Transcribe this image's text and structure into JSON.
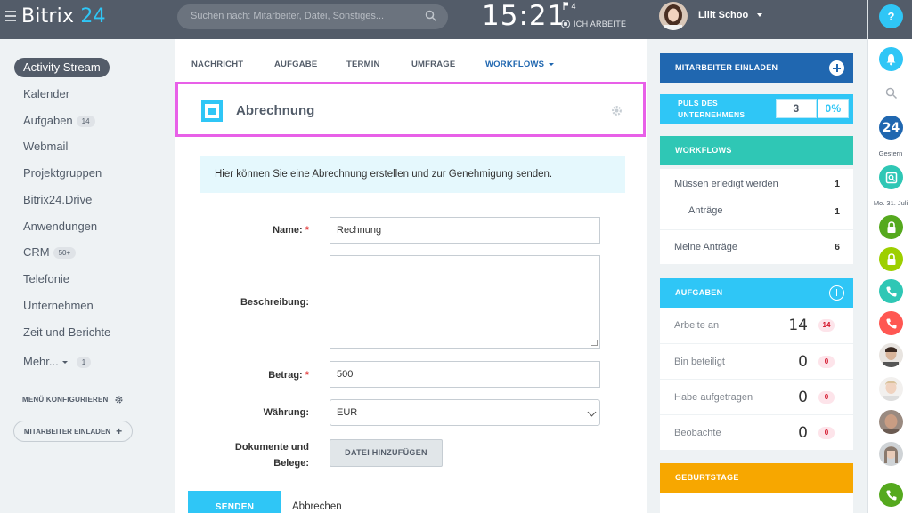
{
  "topbar": {
    "logo_word": "Bitrix",
    "logo_num": "24",
    "search_placeholder": "Suchen nach: Mitarbeiter, Datei, Sonstiges...",
    "clock": "15:21",
    "flag_count": "4",
    "work_status": "ICH ARBEITE",
    "user_name": "Lilit Schoo"
  },
  "sidebar": {
    "items": [
      {
        "label": "Activity Stream",
        "active": true
      },
      {
        "label": "Kalender"
      },
      {
        "label": "Aufgaben",
        "badge": "14"
      },
      {
        "label": "Webmail"
      },
      {
        "label": "Projektgruppen"
      },
      {
        "label": "Bitrix24.Drive"
      },
      {
        "label": "Anwendungen"
      },
      {
        "label": "CRM",
        "badge": "50+"
      },
      {
        "label": "Telefonie"
      },
      {
        "label": "Unternehmen"
      },
      {
        "label": "Zeit und Berichte"
      },
      {
        "label": "Mehr...",
        "badge": "1"
      }
    ],
    "menu_config": "MENÜ KONFIGURIEREN",
    "invite": "MITARBEITER EINLADEN"
  },
  "tabs": [
    "NACHRICHT",
    "AUFGABE",
    "TERMIN",
    "UMFRAGE",
    "WORKFLOWS"
  ],
  "form": {
    "title": "Abrechnung",
    "info": "Hier können Sie eine Abrechnung erstellen und zur Genehmigung senden.",
    "name_label": "Name:",
    "name_value": "Rechnung",
    "desc_label": "Beschreibung:",
    "amount_label": "Betrag:",
    "amount_value": "500",
    "currency_label": "Währung:",
    "currency_value": "EUR",
    "docs_label_1": "Dokumente und",
    "docs_label_2": "Belege:",
    "file_button": "DATEI HINZUFÜGEN",
    "send": "SENDEN",
    "cancel": "Abbrechen"
  },
  "right": {
    "invite": "MITARBEITER EINLADEN",
    "pulse_line1": "PULS DES",
    "pulse_line2": "UNTERNEHMENS",
    "pulse_value": "3",
    "pulse_percent": "0%",
    "workflows_title": "WORKFLOWS",
    "workflows": [
      {
        "label": "Müssen erledigt werden",
        "value": "1"
      },
      {
        "label": "Anträge",
        "value": "1"
      },
      {
        "label": "Meine Anträge",
        "value": "6"
      }
    ],
    "tasks_title": "AUFGABEN",
    "tasks": [
      {
        "label": "Arbeite an",
        "value": "14",
        "count": "14"
      },
      {
        "label": "Bin beteiligt",
        "value": "0",
        "count": "0"
      },
      {
        "label": "Habe aufgetragen",
        "value": "0",
        "count": "0"
      },
      {
        "label": "Beobachte",
        "value": "0",
        "count": "0"
      }
    ],
    "birthdays_title": "GEBURTSTAGE"
  },
  "rightbar": {
    "help": "?",
    "logo": "24",
    "label_yesterday": "Gestern",
    "label_date": "Mo. 31. Juli"
  },
  "colors": {
    "accent_blue": "#2067b0",
    "cyan": "#2fc6f6",
    "teal": "#2fc7b5",
    "orange": "#f7a700",
    "topbar": "#535c69",
    "highlight": "#e860e8"
  }
}
